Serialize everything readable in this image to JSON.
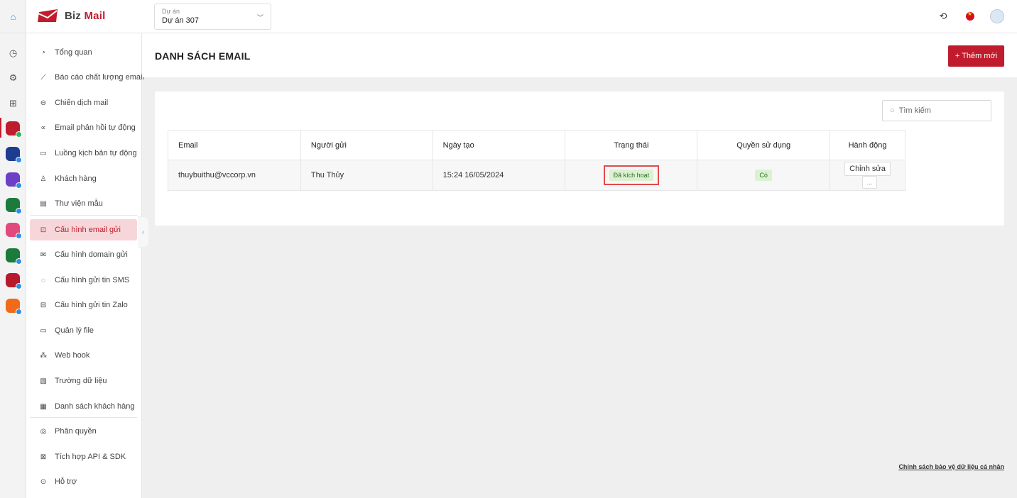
{
  "header": {
    "logo_prefix": "Biz",
    "logo_suffix": "Mail",
    "project_label": "Dự án",
    "project_value": "Dự án 307"
  },
  "icons": {
    "home": "home-icon",
    "support": "headset-icon",
    "language": "vietnam-flag-icon",
    "user": "avatar-icon"
  },
  "sidebar": {
    "items": [
      {
        "label": "Tổng quan",
        "icon": "◔"
      },
      {
        "label": "Báo cáo chất lượng email",
        "icon": "⟋"
      },
      {
        "label": "Chiến dịch mail",
        "icon": "⊖"
      },
      {
        "label": "Email phản hồi tự động",
        "icon": "∝"
      },
      {
        "label": "Luồng kịch bản tự động",
        "icon": "▭"
      },
      {
        "label": "Khách hàng",
        "icon": "♙"
      },
      {
        "label": "Thư viện mẫu",
        "icon": "▤"
      },
      {
        "label": "Cấu hình email gửi",
        "icon": "⊡"
      },
      {
        "label": "Cấu hình domain gửi",
        "icon": "✉"
      },
      {
        "label": "Cấu hình gửi tin SMS",
        "icon": "◌"
      },
      {
        "label": "Cấu hình gửi tin Zalo",
        "icon": "⊟"
      },
      {
        "label": "Quản lý file",
        "icon": "▭"
      },
      {
        "label": "Web hook",
        "icon": "⁂"
      },
      {
        "label": "Trường dữ liệu",
        "icon": "▧"
      },
      {
        "label": "Danh sách khách hàng",
        "icon": "▦"
      },
      {
        "label": "Phân quyền",
        "icon": "◎"
      },
      {
        "label": "Tích hợp API & SDK",
        "icon": "⊠"
      },
      {
        "label": "Hỗ trợ",
        "icon": "⊙"
      }
    ]
  },
  "page": {
    "title": "DANH SÁCH EMAIL",
    "add_button": "+ Thêm mới",
    "search_placeholder": "Tìm kiếm"
  },
  "table": {
    "headers": [
      "Email",
      "Người gửi",
      "Ngày tạo",
      "Trạng thái",
      "Quyền sử dụng",
      "Hành động"
    ],
    "rows": [
      {
        "email": "thuybuithu@vccorp.vn",
        "sender": "Thu Thủy",
        "created": "15:24 16/05/2024",
        "status": "Đã kích hoạt",
        "permission": "Có",
        "edit": "Chỉnh sửa",
        "more": "..."
      }
    ]
  },
  "footer": {
    "privacy_link": "Chính sách bảo vệ dữ liệu cá nhân"
  },
  "colors": {
    "brand": "#c01c2d",
    "active_nav_bg": "#f6d6d9",
    "badge_bg": "#dcf1d2",
    "highlight_border": "#e04b4b"
  }
}
